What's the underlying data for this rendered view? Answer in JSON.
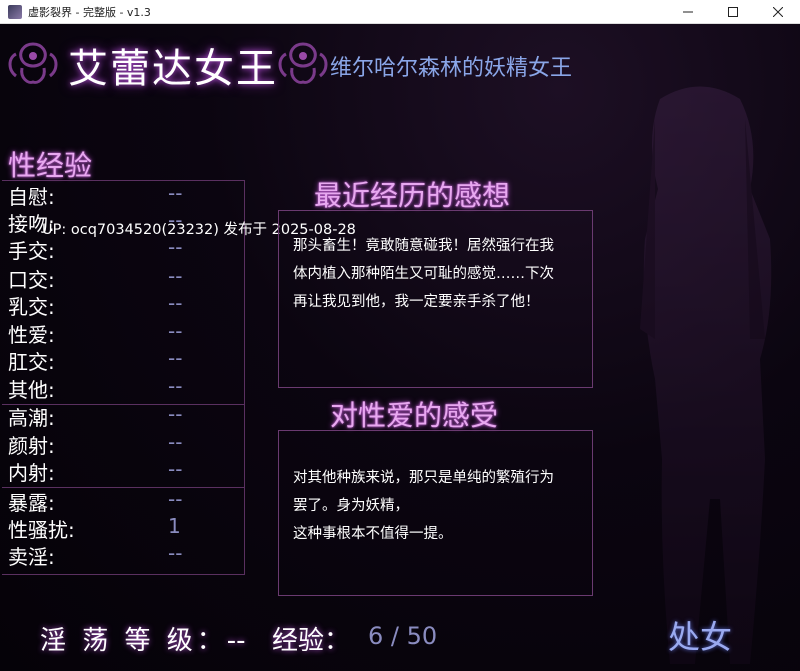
{
  "window": {
    "title": "虚影裂界 - 完整版 - v1.3",
    "minimize_icon": "minimize-icon",
    "maximize_icon": "maximize-icon",
    "close_icon": "close-icon"
  },
  "header": {
    "title": "艾蕾达女王",
    "subtitle": "维尔哈尔森林的妖精女王",
    "ornament_icon": "purple-flame-ornament-icon"
  },
  "colors": {
    "accent": "#b04fd0",
    "heading": "#e8a8f0",
    "value": "#8a8cc0",
    "subtitle": "#8aa6e8",
    "border": "#5a3060"
  },
  "stats": {
    "heading": "性经验",
    "rows": [
      {
        "label": "自慰:",
        "value": "--"
      },
      {
        "label": "接吻:",
        "value": "--"
      },
      {
        "label": "手交:",
        "value": "--"
      },
      {
        "label": "口交:",
        "value": "--"
      },
      {
        "label": "乳交:",
        "value": "--"
      },
      {
        "label": "性爱:",
        "value": "--"
      },
      {
        "label": "肛交:",
        "value": "--"
      },
      {
        "label": "其他:",
        "value": "--"
      },
      {
        "label": "高潮:",
        "value": "--"
      },
      {
        "label": "颜射:",
        "value": "--"
      },
      {
        "label": "内射:",
        "value": "--"
      },
      {
        "label": "暴露:",
        "value": "--"
      },
      {
        "label": "性骚扰:",
        "value": "1"
      },
      {
        "label": "卖淫:",
        "value": "--"
      }
    ]
  },
  "overlay_note": "UP: ocq7034520(23232) 发布于 2025-08-28",
  "recent": {
    "heading": "最近经历的感想",
    "lines": [
      "那头畜生！竟敢随意碰我！居然强行在我",
      "体内植入那种陌生又可耻的感觉……下次",
      "再让我见到他，我一定要亲手杀了他！"
    ]
  },
  "feeling": {
    "heading": "对性爱的感受",
    "lines": [
      "对其他种族来说，那只是单纯的繁殖行为",
      "罢了。身为妖精，",
      "这种事根本不值得一提。"
    ]
  },
  "footer": {
    "lewd_level_label": "淫 荡 等 级：",
    "lewd_level_value": "--",
    "exp_label": "经验：",
    "exp_value": "6 / 50",
    "status": "处女"
  }
}
